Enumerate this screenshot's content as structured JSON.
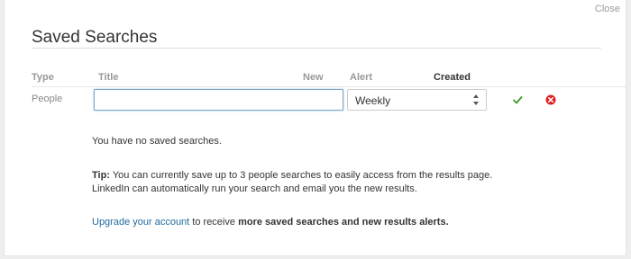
{
  "modal": {
    "close_label": "Close",
    "title": "Saved Searches"
  },
  "table": {
    "headers": {
      "type": "Type",
      "title": "Title",
      "new": "New",
      "alert": "Alert",
      "created": "Created"
    },
    "row": {
      "type": "People",
      "title_value": "",
      "title_placeholder": "",
      "alert_selected": "Weekly"
    }
  },
  "messages": {
    "empty": "You have no saved searches.",
    "tip_label": "Tip:",
    "tip_line1": "You can currently save up to 3 people searches to easily access from the results page.",
    "tip_line2": "LinkedIn can automatically run your search and email you the new results.",
    "upgrade_link": "Upgrade your account",
    "upgrade_middle": "to receive",
    "upgrade_bold": "more saved searches and new results alerts."
  },
  "colors": {
    "link": "#1f6a9e",
    "save_check": "#3d9a2e",
    "cancel_red": "#dd2222",
    "input_focus_border": "#7ba7c9"
  },
  "icons": {
    "save": "checkmark-icon",
    "cancel": "close-circle-icon",
    "select": "up-down-arrows-icon"
  }
}
